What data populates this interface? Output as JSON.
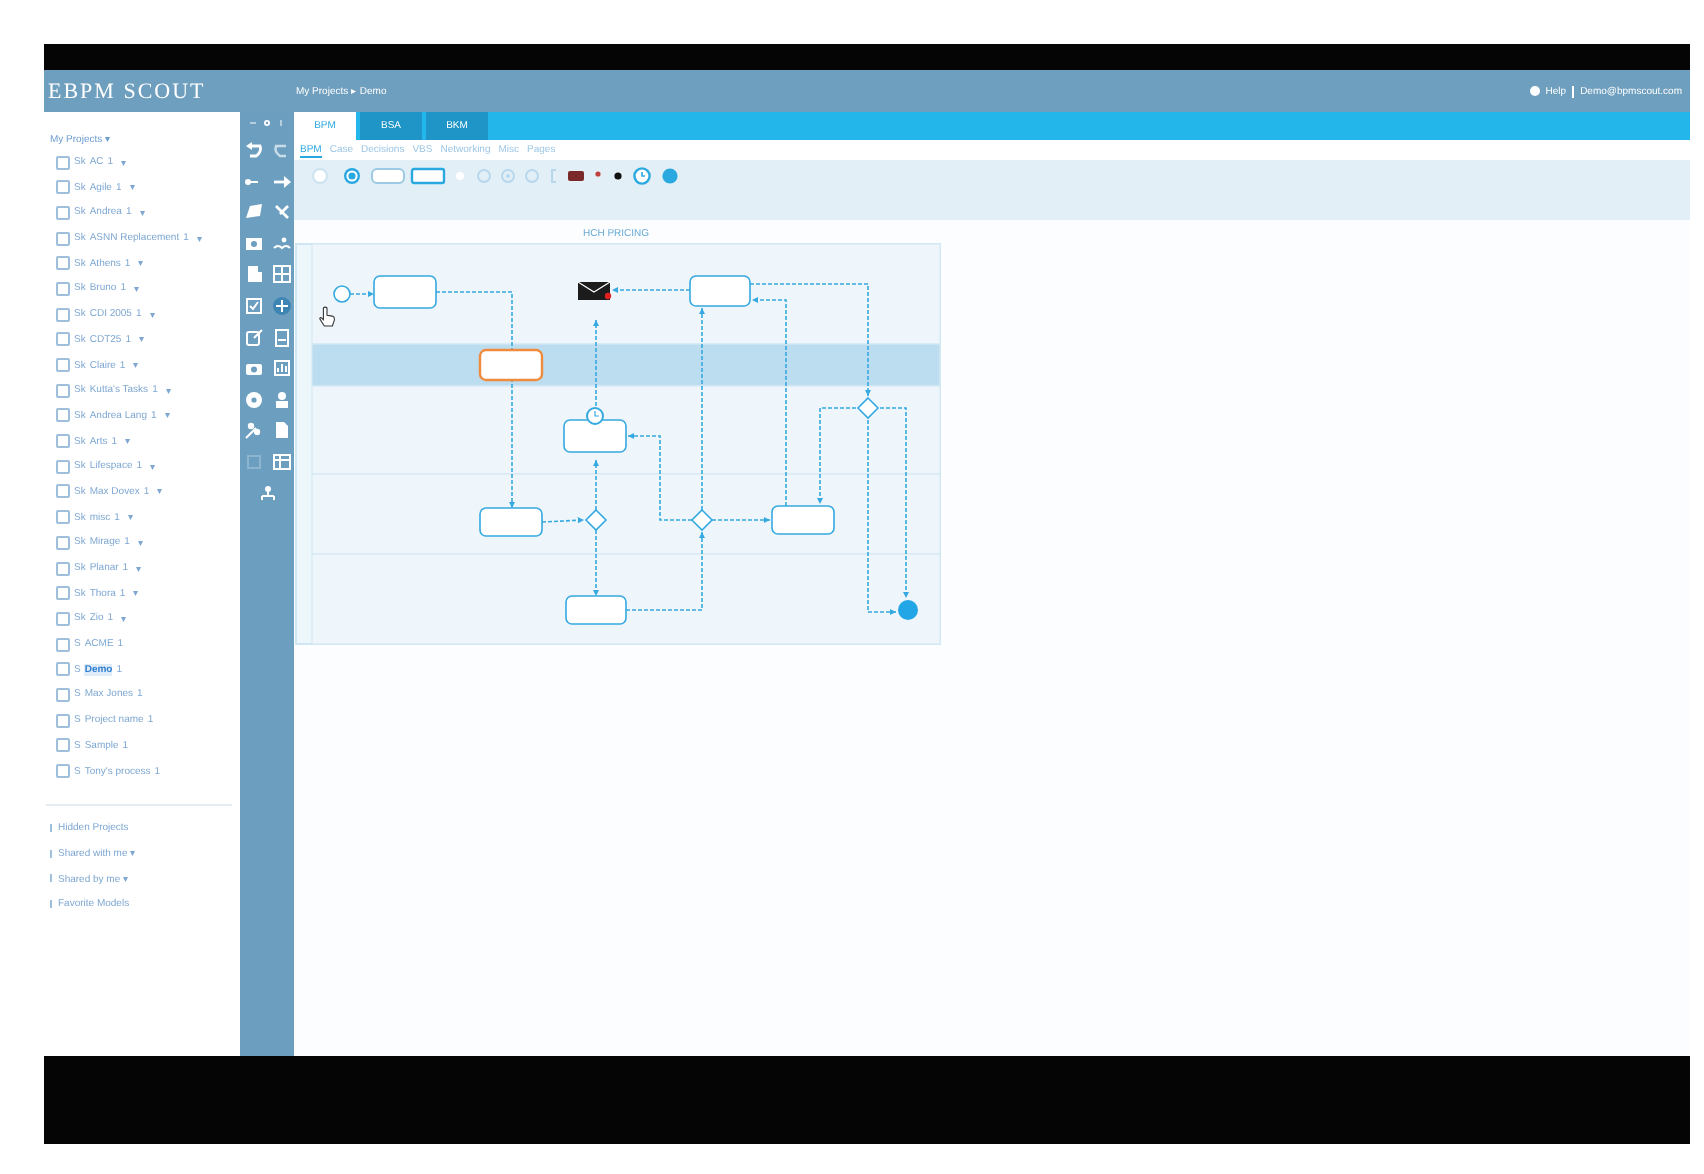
{
  "header": {
    "logo": "EBPM SCOUT",
    "breadcrumb": "My Projects ▸ Demo",
    "help": "Help",
    "user": "Demo@bpmscout.com"
  },
  "sidebar": {
    "root": "My Projects ▾",
    "projects": [
      {
        "prefix": "Sk",
        "name": "AC",
        "count": "1",
        "menu": "▾",
        "checked": false,
        "selected": false
      },
      {
        "prefix": "Sk",
        "name": "Agile",
        "count": "1",
        "menu": "▾",
        "checked": false,
        "selected": false
      },
      {
        "prefix": "Sk",
        "name": "Andrea",
        "count": "1",
        "menu": "▾",
        "checked": false,
        "selected": false
      },
      {
        "prefix": "Sk",
        "name": "ASNN Replacement",
        "count": "1",
        "menu": "▾",
        "checked": false,
        "selected": false
      },
      {
        "prefix": "Sk",
        "name": "Athens",
        "count": "1",
        "menu": "▾",
        "checked": false,
        "selected": false
      },
      {
        "prefix": "Sk",
        "name": "Bruno",
        "count": "1",
        "menu": "▾",
        "checked": false,
        "selected": false
      },
      {
        "prefix": "Sk",
        "name": "CDI 2005",
        "count": "1",
        "menu": "▾",
        "checked": false,
        "selected": false
      },
      {
        "prefix": "Sk",
        "name": "CDT25",
        "count": "1",
        "menu": "▾",
        "checked": false,
        "selected": false
      },
      {
        "prefix": "Sk",
        "name": "Claire",
        "count": "1",
        "menu": "▾",
        "checked": false,
        "selected": false
      },
      {
        "prefix": "Sk",
        "name": "Kutta's Tasks",
        "count": "1",
        "menu": "▾",
        "checked": false,
        "selected": false
      },
      {
        "prefix": "Sk",
        "name": "Andrea Lang",
        "count": "1",
        "menu": "▾",
        "checked": false,
        "selected": false
      },
      {
        "prefix": "Sk",
        "name": "Arts",
        "count": "1",
        "menu": "▾",
        "checked": false,
        "selected": false
      },
      {
        "prefix": "Sk",
        "name": "Lifespace",
        "count": "1",
        "menu": "▾",
        "checked": false,
        "selected": false
      },
      {
        "prefix": "Sk",
        "name": "Max Dovex",
        "count": "1",
        "menu": "▾",
        "checked": false,
        "selected": false
      },
      {
        "prefix": "Sk",
        "name": "misc",
        "count": "1",
        "menu": "▾",
        "checked": false,
        "selected": false
      },
      {
        "prefix": "Sk",
        "name": "Mirage",
        "count": "1",
        "menu": "▾",
        "checked": false,
        "selected": false
      },
      {
        "prefix": "Sk",
        "name": "Planar",
        "count": "1",
        "menu": "▾",
        "checked": false,
        "selected": false
      },
      {
        "prefix": "Sk",
        "name": "Thora",
        "count": "1",
        "menu": "▾",
        "checked": false,
        "selected": false
      },
      {
        "prefix": "Sk",
        "name": "Zio",
        "count": "1",
        "menu": "▾",
        "checked": false,
        "selected": false
      },
      {
        "prefix": "S",
        "name": "ACME",
        "count": "1",
        "checked": false,
        "selected": false
      },
      {
        "prefix": "S",
        "name": "Demo",
        "count": "1",
        "checked": false,
        "selected": true
      },
      {
        "prefix": "S",
        "name": "Max Jones",
        "count": "1",
        "checked": false,
        "selected": false
      },
      {
        "prefix": "S",
        "name": "Project name",
        "count": "1",
        "checked": false,
        "selected": false
      },
      {
        "prefix": "S",
        "name": "Sample",
        "count": "1",
        "checked": false,
        "selected": false
      },
      {
        "prefix": "S",
        "name": "Tony's process",
        "count": "1",
        "checked": false,
        "selected": false
      }
    ],
    "links": [
      "Hidden Projects",
      "Shared with me ▾",
      "Shared by me ▾",
      "Favorite Models"
    ]
  },
  "tabs": [
    {
      "label": "BPM",
      "selected": true
    },
    {
      "label": "BSA",
      "selected": false
    },
    {
      "label": "BKM",
      "selected": false
    }
  ],
  "subtabs": [
    {
      "label": "BPM",
      "selected": true
    },
    {
      "label": "Case",
      "selected": false
    },
    {
      "label": "Decisions",
      "selected": false
    },
    {
      "label": "VBS",
      "selected": false
    },
    {
      "label": "Networking",
      "selected": false
    },
    {
      "label": "Misc",
      "selected": false
    },
    {
      "label": "Pages",
      "selected": false
    }
  ],
  "diagram": {
    "title": "HCH PRICING",
    "lanes": [
      {
        "selected": false
      },
      {
        "selected": true
      },
      {
        "selected": false
      },
      {
        "selected": false
      },
      {
        "selected": false
      }
    ],
    "nodes": [
      {
        "kind": "start"
      },
      {
        "kind": "task",
        "selected": false
      },
      {
        "kind": "message"
      },
      {
        "kind": "task",
        "selected": false
      },
      {
        "kind": "task",
        "selected": true
      },
      {
        "kind": "timer"
      },
      {
        "kind": "task",
        "selected": false
      },
      {
        "kind": "gateway"
      },
      {
        "kind": "gateway"
      },
      {
        "kind": "task",
        "selected": false
      },
      {
        "kind": "gateway"
      },
      {
        "kind": "task",
        "selected": false
      },
      {
        "kind": "end"
      }
    ]
  }
}
